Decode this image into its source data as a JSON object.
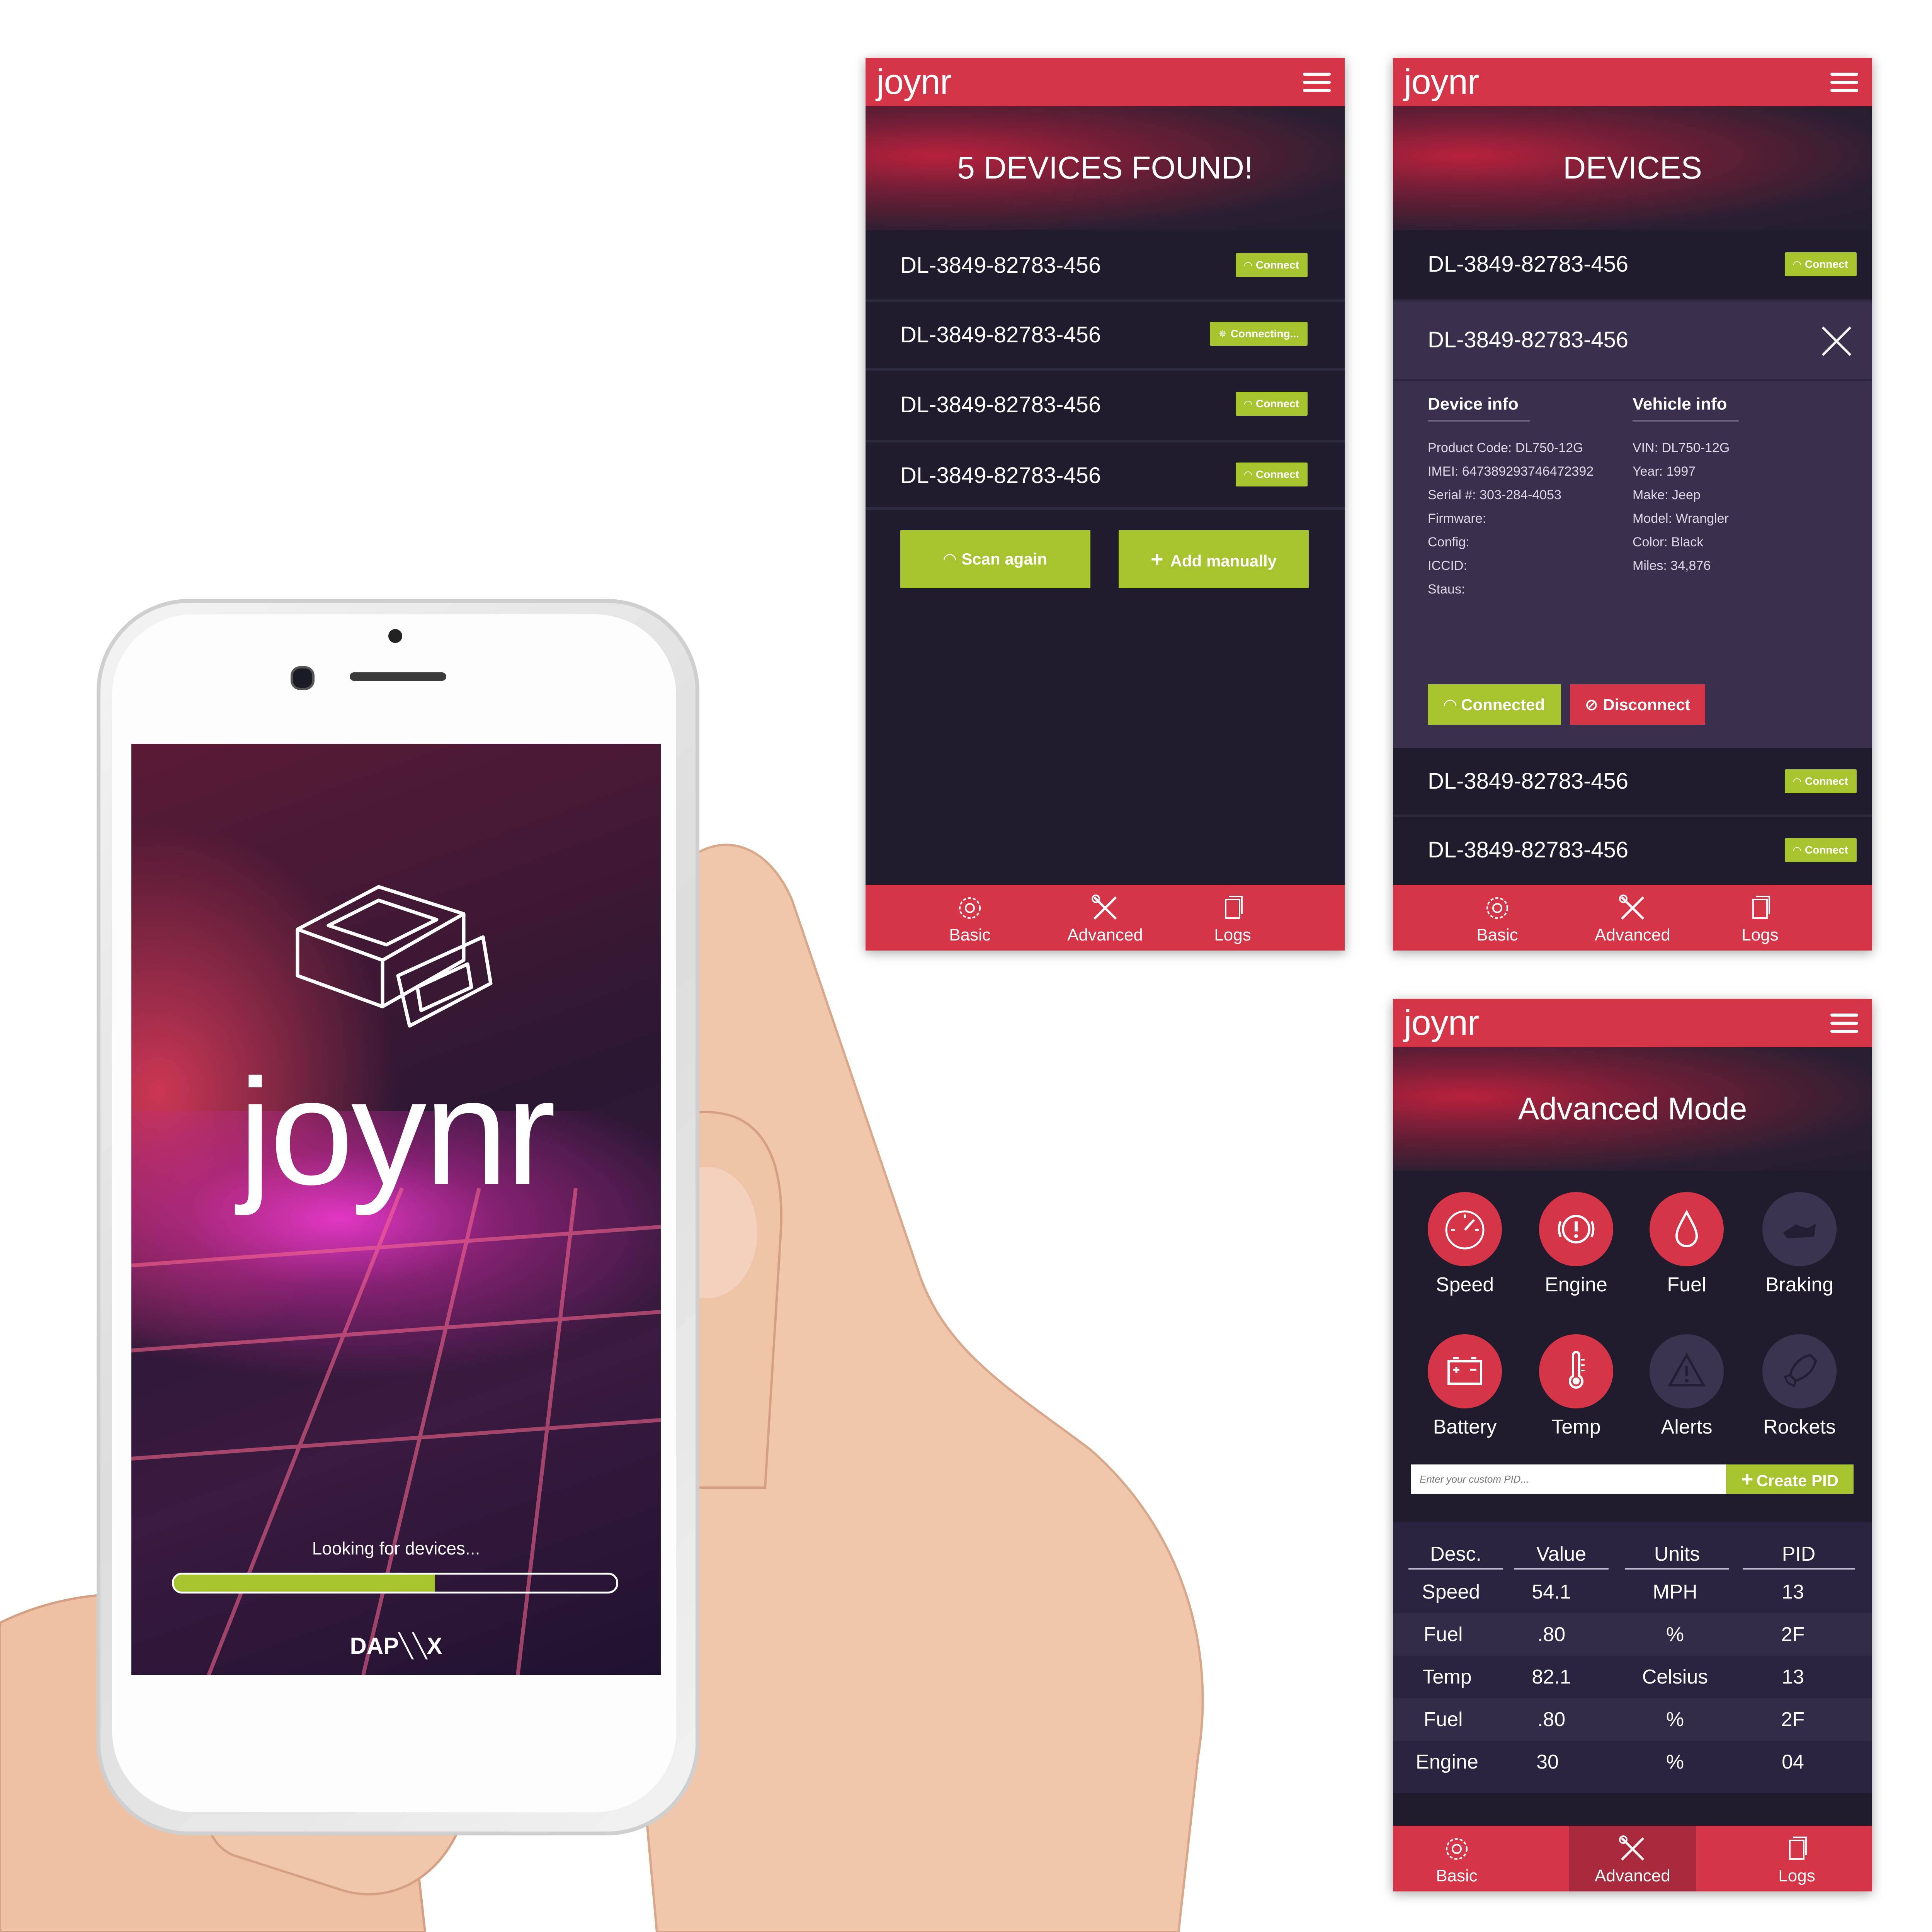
{
  "app": {
    "logo": "joynr"
  },
  "screen_found": {
    "title": "5 DEVICES FOUND!",
    "devices": [
      {
        "id": "DL-3849-82783-456",
        "action": "Connect"
      },
      {
        "id": "DL-3849-82783-456",
        "action": "Connecting..."
      },
      {
        "id": "DL-3849-82783-456",
        "action": "Connect"
      },
      {
        "id": "DL-3849-82783-456",
        "action": "Connect"
      }
    ],
    "scan_label": "Scan again",
    "add_label": "Add manually"
  },
  "screen_devices": {
    "title": "DEVICES",
    "top_device": {
      "id": "DL-3849-82783-456",
      "action": "Connect"
    },
    "selected_device": "DL-3849-82783-456",
    "device_info_heading": "Device info",
    "vehicle_info_heading": "Vehicle info",
    "device_info": [
      "Product Code: DL750-12G",
      "IMEI: 647389293746472392",
      "Serial #: 303-284-4053",
      "Firmware:",
      "Config:",
      "ICCID:",
      "Staus:"
    ],
    "vehicle_info": [
      "VIN: DL750-12G",
      "Year: 1997",
      "Make: Jeep",
      "Model: Wrangler",
      "Color: Black",
      "Miles: 34,876"
    ],
    "connected_label": "Connected",
    "disconnect_label": "Disconnect",
    "bottom_devices": [
      {
        "id": "DL-3849-82783-456",
        "action": "Connect"
      },
      {
        "id": "DL-3849-82783-456",
        "action": "Connect"
      }
    ]
  },
  "screen_advanced": {
    "title": "Advanced Mode",
    "icons": [
      {
        "label": "Speed",
        "icon": "speedometer-icon",
        "active": true
      },
      {
        "label": "Engine",
        "icon": "engine-warning-icon",
        "active": true
      },
      {
        "label": "Fuel",
        "icon": "fuel-drop-icon",
        "active": true
      },
      {
        "label": "Braking",
        "icon": "braking-icon",
        "active": false
      },
      {
        "label": "Battery",
        "icon": "battery-icon",
        "active": true
      },
      {
        "label": "Temp",
        "icon": "thermometer-icon",
        "active": true
      },
      {
        "label": "Alerts",
        "icon": "alert-triangle-icon",
        "active": false
      },
      {
        "label": "Rockets",
        "icon": "rocket-icon",
        "active": false
      }
    ],
    "pid_placeholder": "Enter your custom PID...",
    "create_pid_label": "Create PID",
    "table": {
      "headers": [
        "Desc.",
        "Value",
        "Units",
        "PID"
      ],
      "rows": [
        [
          "Speed",
          "54.1",
          "MPH",
          "13"
        ],
        [
          "Fuel",
          ".80",
          "%",
          "2F"
        ],
        [
          "Temp",
          "82.1",
          "Celsius",
          "13"
        ],
        [
          "Fuel",
          ".80",
          "%",
          "2F"
        ],
        [
          "Engine",
          "30",
          "%",
          "04"
        ]
      ]
    }
  },
  "nav": {
    "basic": "Basic",
    "advanced": "Advanced",
    "logs": "Logs"
  },
  "splash": {
    "logo": "joynr",
    "status": "Looking for devices...",
    "progress": 0.59,
    "brand": "DAP╲╲X"
  },
  "colors": {
    "brand_red": "#d63447",
    "accent_green": "#a6c42e",
    "bg_dark": "#201c2e",
    "panel": "#3a2f4c"
  }
}
